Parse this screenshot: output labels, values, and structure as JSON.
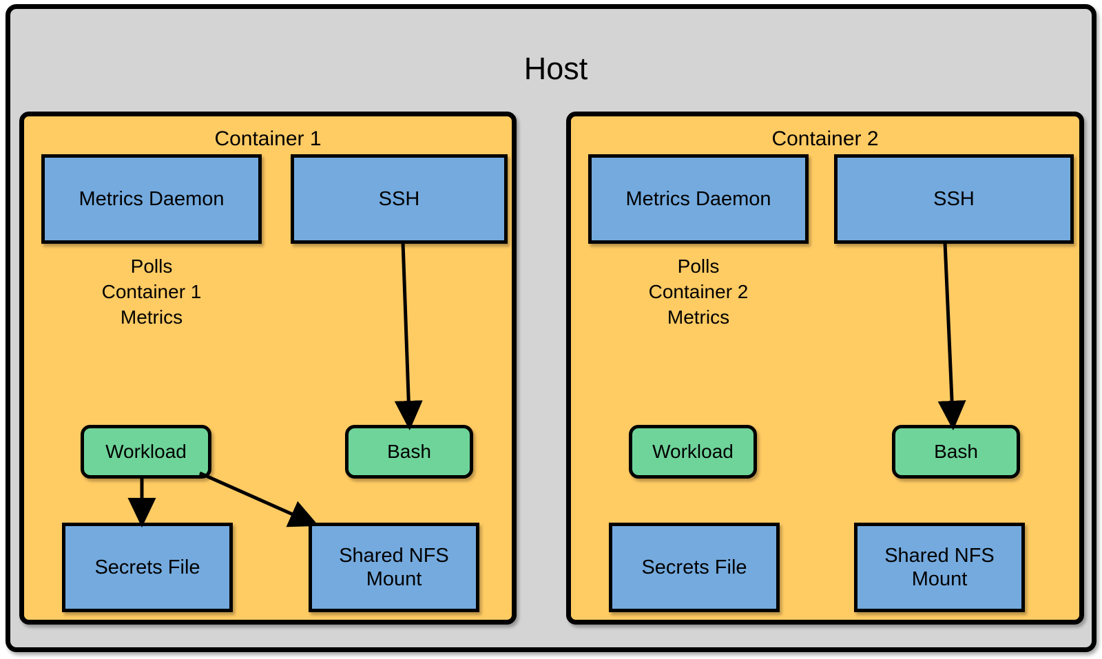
{
  "host": {
    "title": "Host",
    "bg_color": "#d4d4d4",
    "border_color": "#000000"
  },
  "palette": {
    "container_fill": "#ffcb63",
    "process_fill": "#74aade",
    "runtime_fill": "#6fd49a",
    "host_fill": "#d4d4d4",
    "stroke": "#000000"
  },
  "containers": [
    {
      "title": "Container 1",
      "polls_caption": "Polls\nContainer 1\nMetrics",
      "nodes": {
        "metrics_daemon": "Metrics Daemon",
        "ssh": "SSH",
        "workload": "Workload",
        "bash": "Bash",
        "secrets_file": "Secrets\nFile",
        "shared_nfs_mount": "Shared NFS\nMount"
      },
      "arrows": [
        {
          "from": "ssh",
          "to": "bash"
        },
        {
          "from": "workload",
          "to": "secrets_file"
        },
        {
          "from": "workload",
          "to": "shared_nfs_mount"
        }
      ]
    },
    {
      "title": "Container 2",
      "polls_caption": "Polls\nContainer 2\nMetrics",
      "nodes": {
        "metrics_daemon": "Metrics Daemon",
        "ssh": "SSH",
        "workload": "Workload",
        "bash": "Bash",
        "secrets_file": "Secrets\nFile",
        "shared_nfs_mount": "Shared NFS\nMount"
      },
      "arrows": [
        {
          "from": "ssh",
          "to": "bash"
        }
      ]
    }
  ]
}
